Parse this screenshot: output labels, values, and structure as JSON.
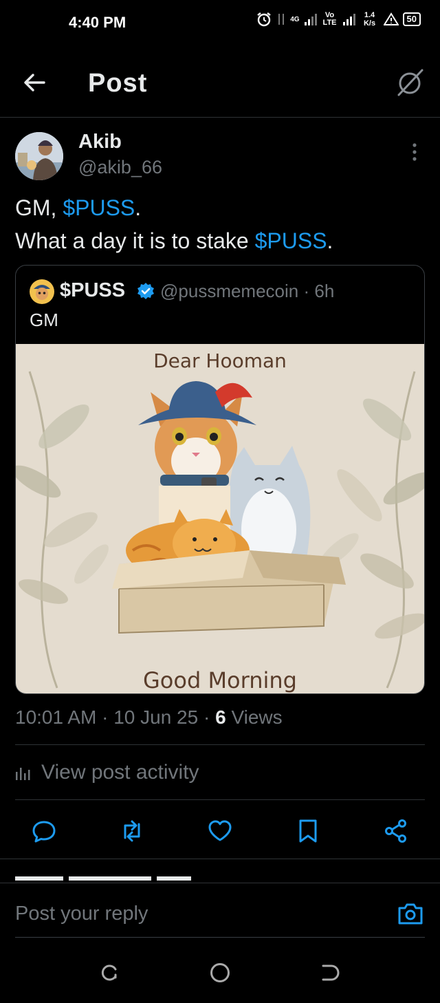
{
  "status_bar": {
    "time": "4:40 PM",
    "network_4g": "4G",
    "volte": "Vo LTE",
    "speed": "1.4 K/s",
    "battery": "50"
  },
  "header": {
    "title": "Post",
    "back_icon": "arrow-left-icon",
    "grok_icon": "grok-icon"
  },
  "post": {
    "author_name": "Akib",
    "author_handle": "@akib_66",
    "text_line1_prefix": "GM, ",
    "text_line1_cashtag": "$PUSS",
    "text_line1_suffix": ".",
    "text_line2_prefix": "What a day it is to stake ",
    "text_line2_cashtag": "$PUSS",
    "text_line2_suffix": ".",
    "time": "10:01 AM",
    "date": "10 Jun 25",
    "views_count": "6",
    "views_label": "Views",
    "sep": "·"
  },
  "quote": {
    "name": "$PUSS",
    "handle": "@pussmemecoin",
    "sep": "·",
    "age": "6h",
    "text": "GM",
    "image_top_text": "Dear Hooman",
    "image_bottom_text": "Good Morning"
  },
  "activity": {
    "label": "View post activity"
  },
  "actions": [
    "reply-icon",
    "repost-icon",
    "like-icon",
    "bookmark-icon",
    "share-icon"
  ],
  "reply_bar": {
    "placeholder": "Post your reply"
  },
  "colors": {
    "accent": "#1d9bf0",
    "background": "#000000",
    "secondary_text": "#71767b"
  }
}
